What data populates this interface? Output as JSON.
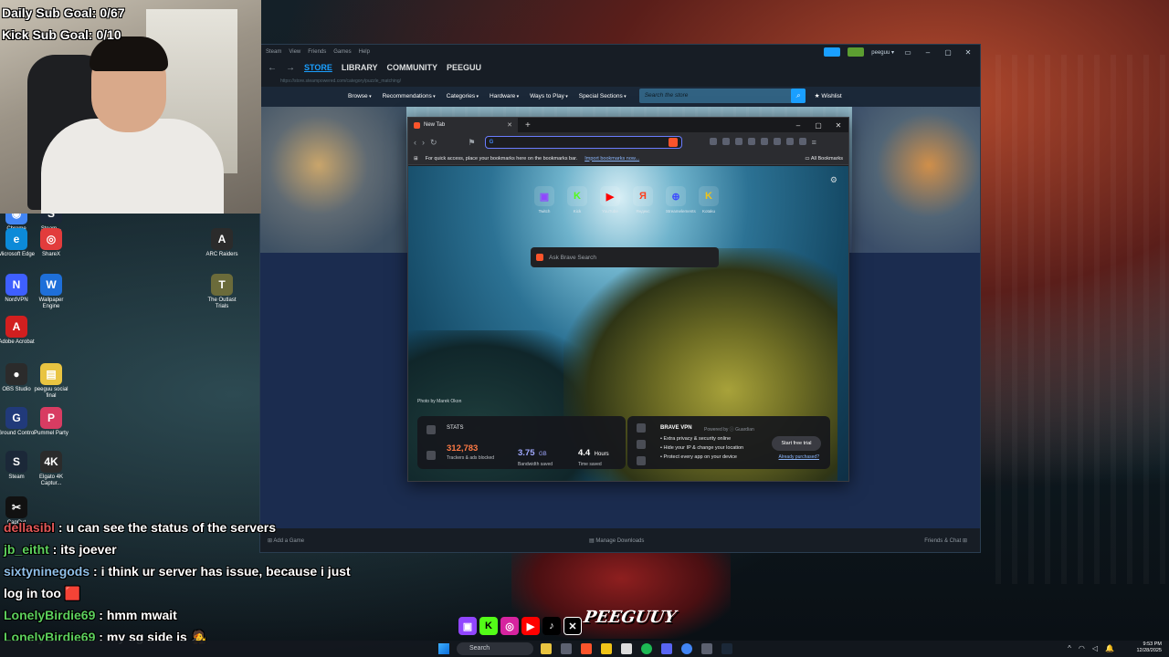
{
  "overlay": {
    "daily_sub_goal": "Daily Sub Goal: 0/67",
    "kick_sub_goal": "Kick Sub Goal: 0/10"
  },
  "desktop_icons": [
    {
      "label": "Chrome",
      "color": "#4285f4",
      "glyph": "◉"
    },
    {
      "label": "Steam...",
      "color": "#1b2838",
      "glyph": "S"
    },
    {
      "label": "Microsoft Edge",
      "color": "#0c8ad8",
      "glyph": "e"
    },
    {
      "label": "ShareX",
      "color": "#e23c3c",
      "glyph": "◎"
    },
    {
      "label": "ARC Raiders",
      "color": "#2b2b2b",
      "glyph": "A"
    },
    {
      "label": "NordVPN",
      "color": "#3e5fff",
      "glyph": "N"
    },
    {
      "label": "Wallpaper Engine",
      "color": "#1e6fd9",
      "glyph": "W"
    },
    {
      "label": "The Outlast Trials",
      "color": "#6b6b3a",
      "glyph": "T"
    },
    {
      "label": "Adobe Acrobat",
      "color": "#d21f1f",
      "glyph": "A"
    },
    {
      "label": "OBS Studio",
      "color": "#2b2b2b",
      "glyph": "●"
    },
    {
      "label": "peeguu social final",
      "color": "#e9c441",
      "glyph": "▤"
    },
    {
      "label": "Ground Control",
      "color": "#213a7a",
      "glyph": "G"
    },
    {
      "label": "Pummel Party",
      "color": "#d83c62",
      "glyph": "P"
    },
    {
      "label": "Steam",
      "color": "#1b2838",
      "glyph": "S"
    },
    {
      "label": "Elgato 4K Captur...",
      "color": "#2b2b2b",
      "glyph": "4K"
    },
    {
      "label": "CapCut",
      "color": "#111",
      "glyph": "✂"
    }
  ],
  "steam": {
    "menu": [
      "Steam",
      "View",
      "Friends",
      "Games",
      "Help"
    ],
    "user": "peeguu ▾",
    "tabs": [
      "STORE",
      "LIBRARY",
      "COMMUNITY",
      "PEEGUU"
    ],
    "active_tab": "STORE",
    "url": "https://store.steampowered.com/category/puzzle_matching/",
    "store_menu": [
      "Browse",
      "Recommendations",
      "Categories",
      "Hardware",
      "Ways to Play",
      "Special Sections"
    ],
    "search_placeholder": "Search the store",
    "wishlist": "Wishlist",
    "add_game": "Add a Game",
    "manage_downloads": "Manage Downloads",
    "friends_chat": "Friends & Chat"
  },
  "brave": {
    "tab_title": "New Tab",
    "bookmarks_hint": "For quick access, place your bookmarks here on the bookmarks bar.",
    "import_link": "Import bookmarks now...",
    "all_bookmarks": "All Bookmarks",
    "shortcuts": [
      {
        "label": "Twitch",
        "glyph": "▣",
        "color": "#9146ff"
      },
      {
        "label": "Kick",
        "glyph": "K",
        "color": "#53fc18"
      },
      {
        "label": "YouTube",
        "glyph": "▶",
        "color": "#ff0000"
      },
      {
        "label": "Яндекс",
        "glyph": "Я",
        "color": "#fc3f1d"
      },
      {
        "label": "Streamelements",
        "glyph": "⊕",
        "color": "#3d4bff"
      },
      {
        "label": "Kotaku",
        "glyph": "K",
        "color": "#f0c419"
      }
    ],
    "search_placeholder": "Ask Brave Search",
    "photo_credit": "Photo by Marek Okon",
    "stats": {
      "title": "STATS",
      "trackers_value": "312,783",
      "trackers_label": "Trackers & ads blocked",
      "bandwidth_value": "3.75",
      "bandwidth_unit": "GB",
      "bandwidth_label": "Bandwidth saved",
      "time_value": "4.4",
      "time_unit": "Hours",
      "time_label": "Time saved"
    },
    "vpn": {
      "title": "BRAVE VPN",
      "powered_by": "Powered by ⓘ Guardian",
      "bullets": [
        "Extra privacy & security online",
        "Hide your IP & change your location",
        "Protect every app on your device"
      ],
      "cta": "Start free trial",
      "link": "Already purchased?"
    }
  },
  "chat": [
    {
      "user": "dellasibl",
      "msg": ": u can see the status of the servers",
      "cls": "red"
    },
    {
      "user": "jb_eitht",
      "msg": ": its joever",
      "cls": ""
    },
    {
      "user": "sixtyninegods",
      "msg": ": i think ur server has issue, because i just log in too 🟥",
      "cls": "blue"
    },
    {
      "user": "LonelyBirdie69",
      "msg": ": hmm mwait",
      "cls": ""
    },
    {
      "user": "LonelyBirdie69",
      "msg": ": my sg side is 🧑‍🎤",
      "cls": ""
    }
  ],
  "brand": "PEEGUUY",
  "taskbar": {
    "search": "Search",
    "time": "9:53 PM",
    "date": "12/28/2025"
  }
}
